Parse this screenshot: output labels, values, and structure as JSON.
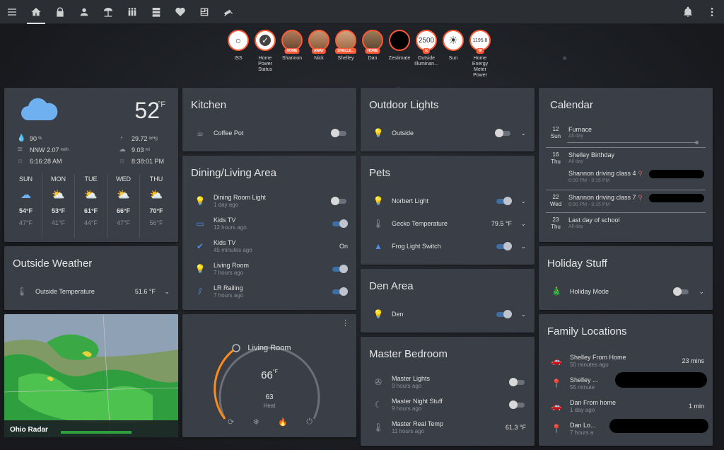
{
  "badges": [
    {
      "label": "ISS",
      "tag": "",
      "glyph": "○"
    },
    {
      "label": "Home Power Status",
      "tag": "",
      "glyph": "✓"
    },
    {
      "label": "Shannon",
      "tag": "HOME"
    },
    {
      "label": "Nick",
      "tag": "AWAY"
    },
    {
      "label": "Shelley",
      "tag": "SHELLE..."
    },
    {
      "label": "Dan",
      "tag": "HOME"
    },
    {
      "label": "Zestimate",
      "tag": ""
    },
    {
      "label": "Outside Illuminan...",
      "tag": "lx",
      "value": "2500"
    },
    {
      "label": "Sun",
      "tag": "",
      "glyph": "☀"
    },
    {
      "label": "Home Energy Meter Power",
      "tag": "W",
      "value": "1195.8"
    }
  ],
  "weather": {
    "temp": "52",
    "unit": "°F",
    "humidity": "90",
    "humidity_unit": "%",
    "pressure": "29.72",
    "pressure_unit": "inHg",
    "wind": "NNW 2.07",
    "wind_unit": "mi/h",
    "visibility": "9.03",
    "visibility_unit": "mi",
    "sunrise": "6:16:28 AM",
    "sunset": "8:38:01 PM",
    "forecast": [
      {
        "day": "SUN",
        "hi": "54°F",
        "lo": "47°F",
        "icon": "☁"
      },
      {
        "day": "MON",
        "hi": "53°F",
        "lo": "41°F",
        "icon": "⛅"
      },
      {
        "day": "TUE",
        "hi": "61°F",
        "lo": "44°F",
        "icon": "⛅"
      },
      {
        "day": "WED",
        "hi": "66°F",
        "lo": "47°F",
        "icon": "⛅"
      },
      {
        "day": "THU",
        "hi": "70°F",
        "lo": "56°F",
        "icon": "⛅"
      }
    ]
  },
  "outside_weather": {
    "title": "Outside Weather",
    "row_label": "Outside Temperature",
    "row_value": "51.6 °F"
  },
  "radar": {
    "label": "Ohio Radar"
  },
  "kitchen": {
    "title": "Kitchen",
    "rows": [
      {
        "label": "Coffee Pot"
      }
    ]
  },
  "dining": {
    "title": "Dining/Living Area",
    "rows": [
      {
        "label": "Dining Room Light",
        "sub": "1 day ago"
      },
      {
        "label": "Kids TV",
        "sub": "12 hours ago"
      },
      {
        "label": "Kids TV",
        "sub": "45 minutes ago",
        "value": "On"
      },
      {
        "label": "Living Room",
        "sub": "7 hours ago"
      },
      {
        "label": "LR Railing",
        "sub": "7 hours ago"
      }
    ]
  },
  "thermostat": {
    "title": "Living Room",
    "target": "66",
    "unit": "°F",
    "current": "63",
    "mode": "Heat"
  },
  "outdoor": {
    "title": "Outdoor Lights",
    "rows": [
      {
        "label": "Outside"
      }
    ]
  },
  "pets": {
    "title": "Pets",
    "rows": [
      {
        "label": "Norbert Light"
      },
      {
        "label": "Gecko Temperature",
        "value": "79.5 °F"
      },
      {
        "label": "Frog Light Switch"
      }
    ]
  },
  "den": {
    "title": "Den Area",
    "rows": [
      {
        "label": "Den"
      }
    ]
  },
  "master": {
    "title": "Master Bedroom",
    "rows": [
      {
        "label": "Master Lights",
        "sub": "9 hours ago"
      },
      {
        "label": "Master Night Stuff",
        "sub": "9 hours ago"
      },
      {
        "label": "Master Real Temp",
        "sub": "11 hours ago",
        "value": "61.3 °F"
      }
    ]
  },
  "calendar": {
    "title": "Calendar",
    "events": [
      {
        "day": "12",
        "dow": "Sun",
        "title": "Furnace",
        "sub": "All day"
      },
      {
        "day": "16",
        "dow": "Thu",
        "title": "Shelley Birthday",
        "sub": "All day"
      },
      {
        "day": "",
        "dow": "",
        "title": "Shannon driving class 4",
        "sub": "6:00 PM - 9:15 PM"
      },
      {
        "day": "22",
        "dow": "Wed",
        "title": "Shannon driving class 7",
        "sub": "6:00 PM - 9:15 PM"
      },
      {
        "day": "23",
        "dow": "Thu",
        "title": "Last day of school",
        "sub": "All day"
      }
    ]
  },
  "holiday": {
    "title": "Holiday Stuff",
    "rows": [
      {
        "label": "Holiday Mode"
      }
    ]
  },
  "family": {
    "title": "Family Locations",
    "rows": [
      {
        "label": "Shelley From Home",
        "sub": "50 minutes ago",
        "value": "23 mins"
      },
      {
        "label": "Shelley ...",
        "sub": "55 minute"
      },
      {
        "label": "Dan From home",
        "sub": "1 day ago",
        "value": "1 min"
      },
      {
        "label": "Dan Lo...",
        "sub": "7 hours a"
      }
    ]
  },
  "colors": {
    "accent": "#ff5a36",
    "card": "#3a3e46",
    "toggle_on": "#3d6fa5",
    "heat": "#ff8c1a"
  }
}
